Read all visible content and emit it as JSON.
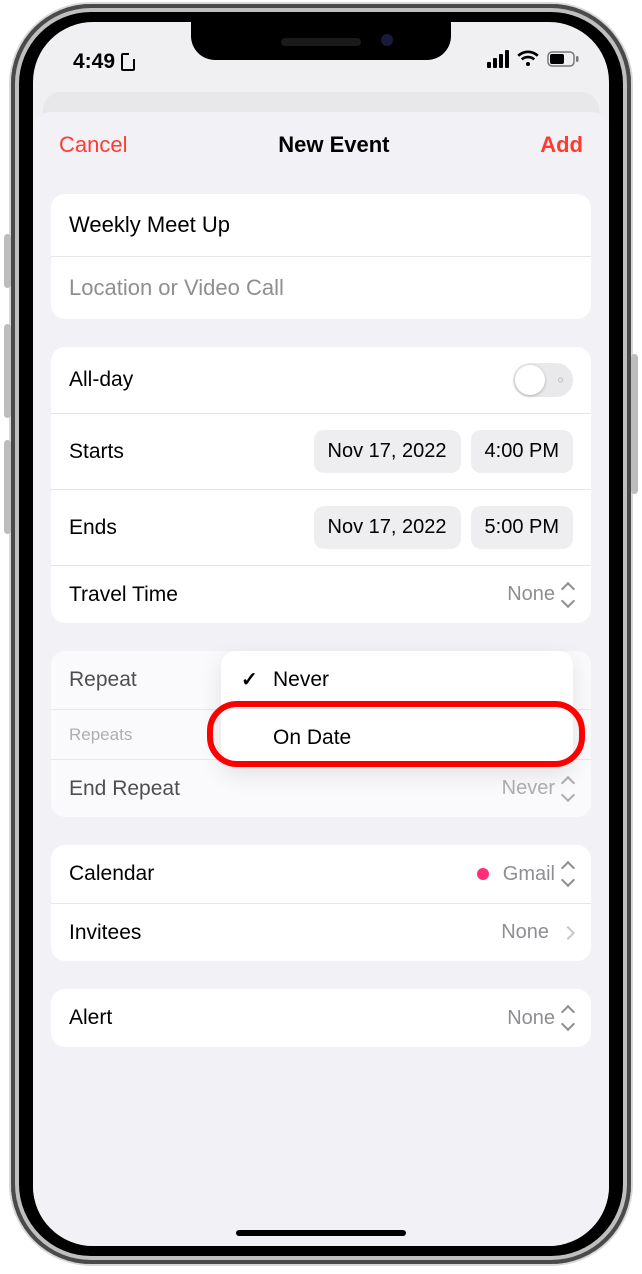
{
  "statusbar": {
    "time": "4:49"
  },
  "nav": {
    "cancel": "Cancel",
    "title": "New Event",
    "add": "Add"
  },
  "event": {
    "title_value": "Weekly Meet Up",
    "location_placeholder": "Location or Video Call"
  },
  "datetime": {
    "allday_label": "All-day",
    "starts_label": "Starts",
    "starts_date": "Nov 17, 2022",
    "starts_time": "4:00 PM",
    "ends_label": "Ends",
    "ends_date": "Nov 17, 2022",
    "ends_time": "5:00 PM",
    "travel_label": "Travel Time",
    "travel_value": "None"
  },
  "repeat": {
    "repeat_label": "Repeat",
    "repeats_small": "Repeats",
    "end_repeat_label": "End Repeat",
    "end_repeat_value": "Never",
    "popover_never": "Never",
    "popover_ondate": "On Date"
  },
  "calendar": {
    "calendar_label": "Calendar",
    "calendar_value": "Gmail",
    "invitees_label": "Invitees",
    "invitees_value": "None"
  },
  "alert": {
    "alert_label": "Alert",
    "alert_value": "None"
  }
}
